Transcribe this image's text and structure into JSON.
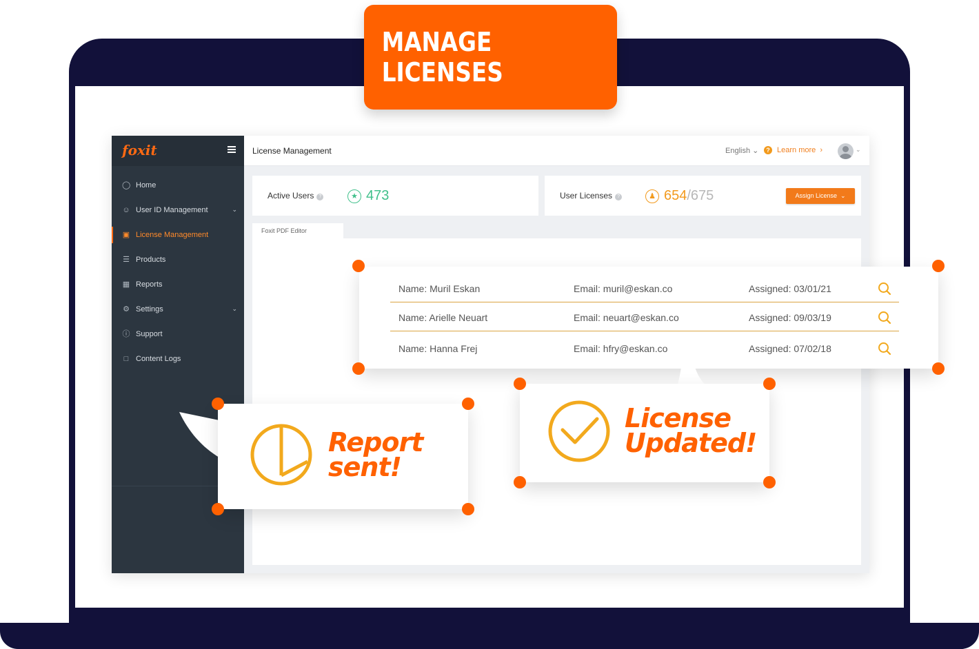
{
  "badge": {
    "title": "MANAGE LICENSES"
  },
  "sidebar": {
    "logo": "foxit",
    "items": [
      {
        "label": "Home",
        "icon": "home-icon"
      },
      {
        "label": "User ID Management",
        "icon": "users-icon"
      },
      {
        "label": "License Management",
        "icon": "license-icon"
      },
      {
        "label": "Products",
        "icon": "products-icon"
      },
      {
        "label": "Reports",
        "icon": "reports-icon"
      },
      {
        "label": "Settings",
        "icon": "gear-icon"
      },
      {
        "label": "Support",
        "icon": "support-icon"
      },
      {
        "label": "Content Logs",
        "icon": "clipboard-icon"
      }
    ]
  },
  "topbar": {
    "title": "License Management",
    "language": "English",
    "learn_more": "Learn more"
  },
  "stats": {
    "active_users_label": "Active Users",
    "active_users_value": "473",
    "user_licenses_label": "User Licenses",
    "user_licenses_used": "654",
    "user_licenses_total": "/675",
    "assign_button": "Assign License"
  },
  "tabs": {
    "active": "Foxit PDF Editor"
  },
  "license_rows": [
    {
      "name": "Name: Muril Eskan",
      "email": "Email: muril@eskan.co",
      "assigned": "Assigned: 03/01/21"
    },
    {
      "name": "Name: Arielle Neuart",
      "email": "Email: neuart@eskan.co",
      "assigned": "Assigned: 09/03/19"
    },
    {
      "name": "Name: Hanna Frej",
      "email": "Email: hfry@eskan.co",
      "assigned": "Assigned: 07/02/18"
    }
  ],
  "callouts": {
    "report_line1": "Report",
    "report_line2": "sent!",
    "license_line1": "License",
    "license_line2": "Updated!"
  },
  "colors": {
    "accent": "#ff6100",
    "frame": "#12113a",
    "sidebar": "#2c3640",
    "gold": "#f2a91d",
    "green": "#41c08b"
  }
}
